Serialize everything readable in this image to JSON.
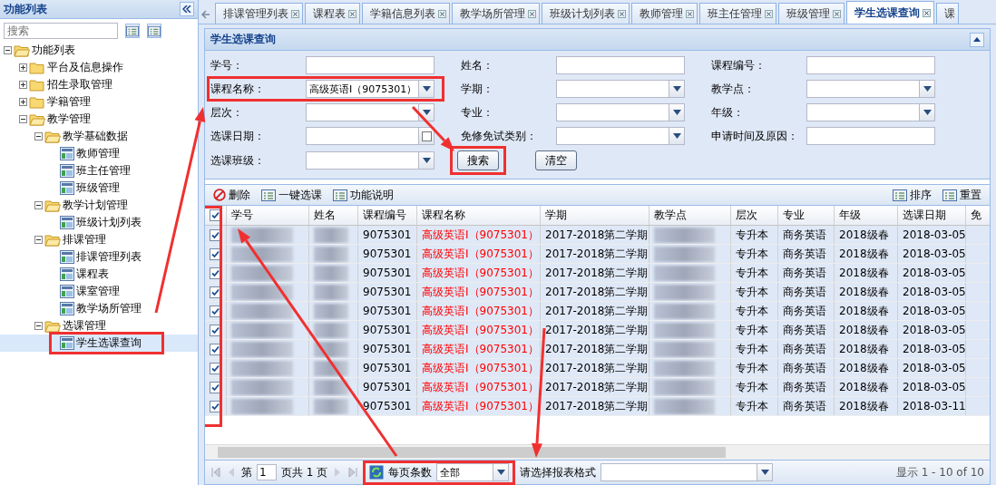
{
  "sidebar": {
    "title": "功能列表",
    "search": {
      "placeholder": "搜索"
    },
    "tree": [
      {
        "label": "功能列表",
        "kind": "folder",
        "expanded": true,
        "selected": false,
        "highlighted": false,
        "children": [
          {
            "label": "平台及信息操作",
            "kind": "folder",
            "expanded": false,
            "selected": false,
            "highlighted": false
          },
          {
            "label": "招生录取管理",
            "kind": "folder",
            "expanded": false,
            "selected": false,
            "highlighted": false
          },
          {
            "label": "学籍管理",
            "kind": "folder",
            "expanded": false,
            "selected": false,
            "highlighted": false
          },
          {
            "label": "教学管理",
            "kind": "folder",
            "expanded": true,
            "selected": false,
            "highlighted": false,
            "children": [
              {
                "label": "教学基础数据",
                "kind": "folder",
                "expanded": true,
                "selected": false,
                "highlighted": false,
                "children": [
                  {
                    "label": "教师管理",
                    "kind": "page",
                    "selected": false,
                    "highlighted": false
                  },
                  {
                    "label": "班主任管理",
                    "kind": "page",
                    "selected": false,
                    "highlighted": false
                  },
                  {
                    "label": "班级管理",
                    "kind": "page",
                    "selected": false,
                    "highlighted": false
                  }
                ]
              },
              {
                "label": "教学计划管理",
                "kind": "folder",
                "expanded": true,
                "selected": false,
                "highlighted": false,
                "children": [
                  {
                    "label": "班级计划列表",
                    "kind": "page",
                    "selected": false,
                    "highlighted": false
                  }
                ]
              },
              {
                "label": "排课管理",
                "kind": "folder",
                "expanded": true,
                "selected": false,
                "highlighted": false,
                "children": [
                  {
                    "label": "排课管理列表",
                    "kind": "page",
                    "selected": false,
                    "highlighted": false
                  },
                  {
                    "label": "课程表",
                    "kind": "page",
                    "selected": false,
                    "highlighted": false
                  },
                  {
                    "label": "课室管理",
                    "kind": "page",
                    "selected": false,
                    "highlighted": false
                  },
                  {
                    "label": "教学场所管理",
                    "kind": "page",
                    "selected": false,
                    "highlighted": false
                  }
                ]
              },
              {
                "label": "选课管理",
                "kind": "folder",
                "expanded": true,
                "selected": false,
                "highlighted": false,
                "children": [
                  {
                    "label": "学生选课查询",
                    "kind": "page",
                    "selected": true,
                    "highlighted": true
                  }
                ]
              }
            ]
          }
        ]
      }
    ]
  },
  "tabs": [
    {
      "label": "排课管理列表",
      "selected": false
    },
    {
      "label": "课程表",
      "selected": false
    },
    {
      "label": "学籍信息列表",
      "selected": false
    },
    {
      "label": "教学场所管理",
      "selected": false
    },
    {
      "label": "班级计划列表",
      "selected": false
    },
    {
      "label": "教师管理",
      "selected": false
    },
    {
      "label": "班主任管理",
      "selected": false
    },
    {
      "label": "班级管理",
      "selected": false
    },
    {
      "label": "学生选课查询",
      "selected": true
    },
    {
      "label": "课",
      "selected": false
    }
  ],
  "panel": {
    "title": "学生选课查询",
    "fields": [
      {
        "label": "学号：",
        "kind": "text",
        "highlighted": false
      },
      {
        "label": "姓名：",
        "kind": "text",
        "highlighted": false
      },
      {
        "label": "课程编号：",
        "kind": "text",
        "highlighted": false
      },
      {
        "label": "课程名称：",
        "kind": "select",
        "value": "高级英语I（9075301）",
        "highlighted": true
      },
      {
        "label": "学期：",
        "kind": "select",
        "highlighted": false
      },
      {
        "label": "教学点：",
        "kind": "select",
        "highlighted": false
      },
      {
        "label": "层次：",
        "kind": "select",
        "highlighted": false
      },
      {
        "label": "专业：",
        "kind": "select",
        "highlighted": false
      },
      {
        "label": "年级：",
        "kind": "select",
        "highlighted": false
      },
      {
        "label": "选课日期：",
        "kind": "date",
        "highlighted": false
      },
      {
        "label": "免修免试类别：",
        "kind": "select",
        "highlighted": false
      },
      {
        "label": "申请时间及原因：",
        "kind": "text",
        "highlighted": false
      },
      {
        "label": "选课班级：",
        "kind": "select",
        "highlighted": false
      }
    ],
    "buttons": [
      {
        "label": "搜索",
        "highlighted": true
      },
      {
        "label": "清空",
        "highlighted": false
      }
    ]
  },
  "grid": {
    "toolbar_left": [
      {
        "label": "删除",
        "kind": "delete"
      },
      {
        "label": "一键选课",
        "kind": "list"
      },
      {
        "label": "功能说明",
        "kind": "list"
      }
    ],
    "toolbar_right": [
      {
        "label": "排序",
        "kind": "list"
      },
      {
        "label": "重置",
        "kind": "list"
      }
    ],
    "all_checked": true,
    "checkbox_column_highlighted": true,
    "columns": [
      {
        "label": "学号",
        "kind": "redacted"
      },
      {
        "label": "姓名",
        "kind": "redacted"
      },
      {
        "label": "课程编号",
        "kind": "text"
      },
      {
        "label": "课程名称",
        "kind": "highlight"
      },
      {
        "label": "学期",
        "kind": "text"
      },
      {
        "label": "教学点",
        "kind": "redacted"
      },
      {
        "label": "层次",
        "kind": "text"
      },
      {
        "label": "专业",
        "kind": "text"
      },
      {
        "label": "年级",
        "kind": "text"
      },
      {
        "label": "选课日期",
        "kind": "text"
      },
      {
        "label": "免",
        "kind": "text"
      }
    ],
    "rows": [
      {
        "checked": true,
        "cells": [
          null,
          null,
          "9075301",
          "高级英语I（9075301）",
          "2017-2018第二学期",
          null,
          "专升本",
          "商务英语",
          "2018级春",
          "2018-03-05"
        ]
      },
      {
        "checked": true,
        "cells": [
          null,
          null,
          "9075301",
          "高级英语I（9075301）",
          "2017-2018第二学期",
          null,
          "专升本",
          "商务英语",
          "2018级春",
          "2018-03-05"
        ]
      },
      {
        "checked": true,
        "cells": [
          null,
          null,
          "9075301",
          "高级英语I（9075301）",
          "2017-2018第二学期",
          null,
          "专升本",
          "商务英语",
          "2018级春",
          "2018-03-05"
        ]
      },
      {
        "checked": true,
        "cells": [
          null,
          null,
          "9075301",
          "高级英语I（9075301）",
          "2017-2018第二学期",
          null,
          "专升本",
          "商务英语",
          "2018级春",
          "2018-03-05"
        ]
      },
      {
        "checked": true,
        "cells": [
          null,
          null,
          "9075301",
          "高级英语I（9075301）",
          "2017-2018第二学期",
          null,
          "专升本",
          "商务英语",
          "2018级春",
          "2018-03-05"
        ]
      },
      {
        "checked": true,
        "cells": [
          null,
          null,
          "9075301",
          "高级英语I（9075301）",
          "2017-2018第二学期",
          null,
          "专升本",
          "商务英语",
          "2018级春",
          "2018-03-05"
        ]
      },
      {
        "checked": true,
        "cells": [
          null,
          null,
          "9075301",
          "高级英语I（9075301）",
          "2017-2018第二学期",
          null,
          "专升本",
          "商务英语",
          "2018级春",
          "2018-03-05"
        ]
      },
      {
        "checked": true,
        "cells": [
          null,
          null,
          "9075301",
          "高级英语I（9075301）",
          "2017-2018第二学期",
          null,
          "专升本",
          "商务英语",
          "2018级春",
          "2018-03-05"
        ]
      },
      {
        "checked": true,
        "cells": [
          null,
          null,
          "9075301",
          "高级英语I（9075301）",
          "2017-2018第二学期",
          null,
          "专升本",
          "商务英语",
          "2018级春",
          "2018-03-05"
        ]
      },
      {
        "checked": true,
        "cells": [
          null,
          null,
          "9075301",
          "高级英语I（9075301）",
          "2017-2018第二学期",
          null,
          "专升本",
          "商务英语",
          "2018级春",
          "2018-03-11"
        ]
      }
    ],
    "pager": {
      "page_prefix": "第",
      "page": "1",
      "page_suffix": "页共 1 页",
      "page_size_label": "每页条数",
      "page_size": "全部",
      "format_label": "请选择报表格式",
      "summary": "显示 1 - 10 of 10",
      "highlighted": true
    }
  }
}
